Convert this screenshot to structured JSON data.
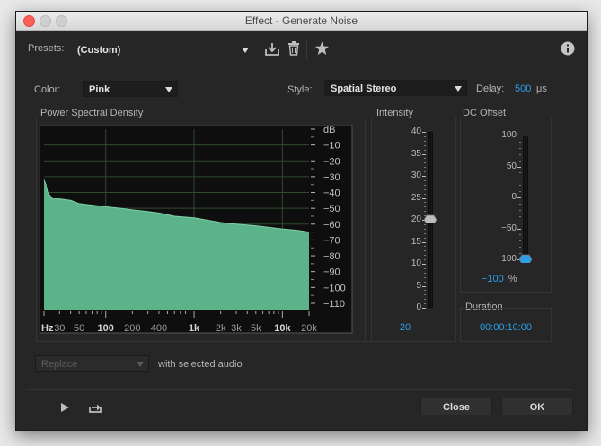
{
  "window": {
    "title": "Effect - Generate Noise"
  },
  "presets": {
    "label": "Presets:",
    "value": "(Custom)",
    "icons": [
      "save-preset-icon",
      "delete-preset-icon",
      "favorite-star-icon",
      "info-icon"
    ]
  },
  "color": {
    "label": "Color:",
    "value": "Pink"
  },
  "style": {
    "label": "Style:",
    "value": "Spatial Stereo"
  },
  "delay": {
    "label": "Delay:",
    "value": "500",
    "unit": "μs"
  },
  "psd": {
    "label": "Power Spectral Density",
    "fill_color": "#5cb38a",
    "db_labels": [
      "dB",
      "−10",
      "−20",
      "−30",
      "−40",
      "−50",
      "−60",
      "−70",
      "−80",
      "−90",
      "−100",
      "−110"
    ],
    "hz_labels": [
      "Hz",
      "30",
      "50",
      "100",
      "200",
      "400",
      "1k",
      "2k",
      "3k",
      "5k",
      "10k",
      "20k"
    ]
  },
  "chart_data": {
    "type": "area",
    "title": "Power Spectral Density",
    "xlabel": "Hz",
    "ylabel": "dB",
    "x_scale": "log",
    "x": [
      20,
      21,
      22,
      25,
      30,
      40,
      50,
      70,
      100,
      150,
      200,
      300,
      400,
      600,
      1000,
      2000,
      3000,
      5000,
      10000,
      15000,
      20000
    ],
    "values": [
      -32,
      -35,
      -40,
      -44,
      -44,
      -45,
      -47,
      -48,
      -49,
      -50,
      -51,
      -52,
      -53,
      -55,
      -56,
      -59,
      -60,
      -61,
      -63,
      -64,
      -65
    ],
    "ylim": [
      -114,
      0
    ],
    "xlim": [
      20,
      20000
    ],
    "grid": true
  },
  "intensity": {
    "label": "Intensity",
    "ticks": [
      "40",
      "35",
      "30",
      "25",
      "20",
      "15",
      "10",
      "5",
      "0"
    ],
    "value": "20",
    "level": 20,
    "max": 40
  },
  "dc_offset": {
    "label": "DC Offset",
    "ticks": [
      "100",
      "50",
      "0",
      "−50",
      "−100"
    ],
    "value": "−100",
    "unit": "%",
    "level": -100
  },
  "duration": {
    "label": "Duration",
    "value": "00:00:10:00"
  },
  "replace": {
    "value": "Replace",
    "suffix": "with selected audio"
  },
  "footer": {
    "close_label": "Close",
    "ok_label": "OK"
  },
  "colors": {
    "accent_blue": "#2d9ee8",
    "spectrum_green": "#5cb38a",
    "background": "#262626"
  }
}
